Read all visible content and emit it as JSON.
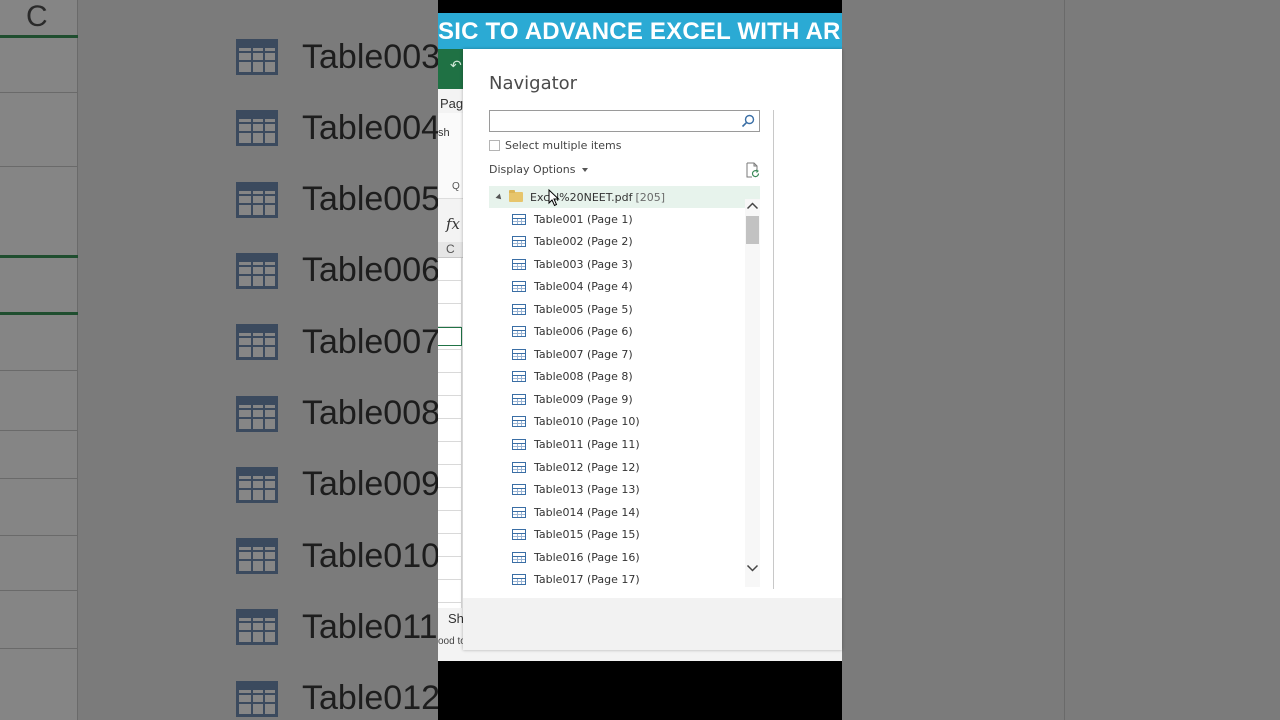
{
  "banner": {
    "text": "SIC TO ADVANCE EXCEL WITH ARRA"
  },
  "background": {
    "column_letter": "C",
    "tables": [
      "Table003",
      "Table004",
      "Table005",
      "Table006",
      "Table007",
      "Table008",
      "Table009",
      "Table010",
      "Table011",
      "Table012"
    ]
  },
  "excel": {
    "tab_fragment": "Pag",
    "ribbon_fragment": "sh",
    "group_fragment": "Q",
    "fx": "fx",
    "column": "C",
    "sheet_fragment": "Sh",
    "status_fragment": "ood to"
  },
  "navigator": {
    "title": "Navigator",
    "search": {
      "value": "",
      "placeholder": ""
    },
    "select_multiple_label": "Select multiple items",
    "display_options_label": "Display Options",
    "root": {
      "label": "Excel%20NEET.pdf",
      "count": "[205]"
    },
    "items": [
      "Table001 (Page 1)",
      "Table002 (Page 2)",
      "Table003 (Page 3)",
      "Table004 (Page 4)",
      "Table005 (Page 5)",
      "Table006 (Page 6)",
      "Table007 (Page 7)",
      "Table008 (Page 8)",
      "Table009 (Page 9)",
      "Table010 (Page 10)",
      "Table011 (Page 11)",
      "Table012 (Page 12)",
      "Table013 (Page 13)",
      "Table014 (Page 14)",
      "Table015 (Page 15)",
      "Table016 (Page 16)",
      "Table017 (Page 17)"
    ]
  },
  "colors": {
    "banner": "#2baad4",
    "excel_green": "#1f7144",
    "tree_selected": "#e7f3ec",
    "table_icon": "#3a6ea5"
  }
}
